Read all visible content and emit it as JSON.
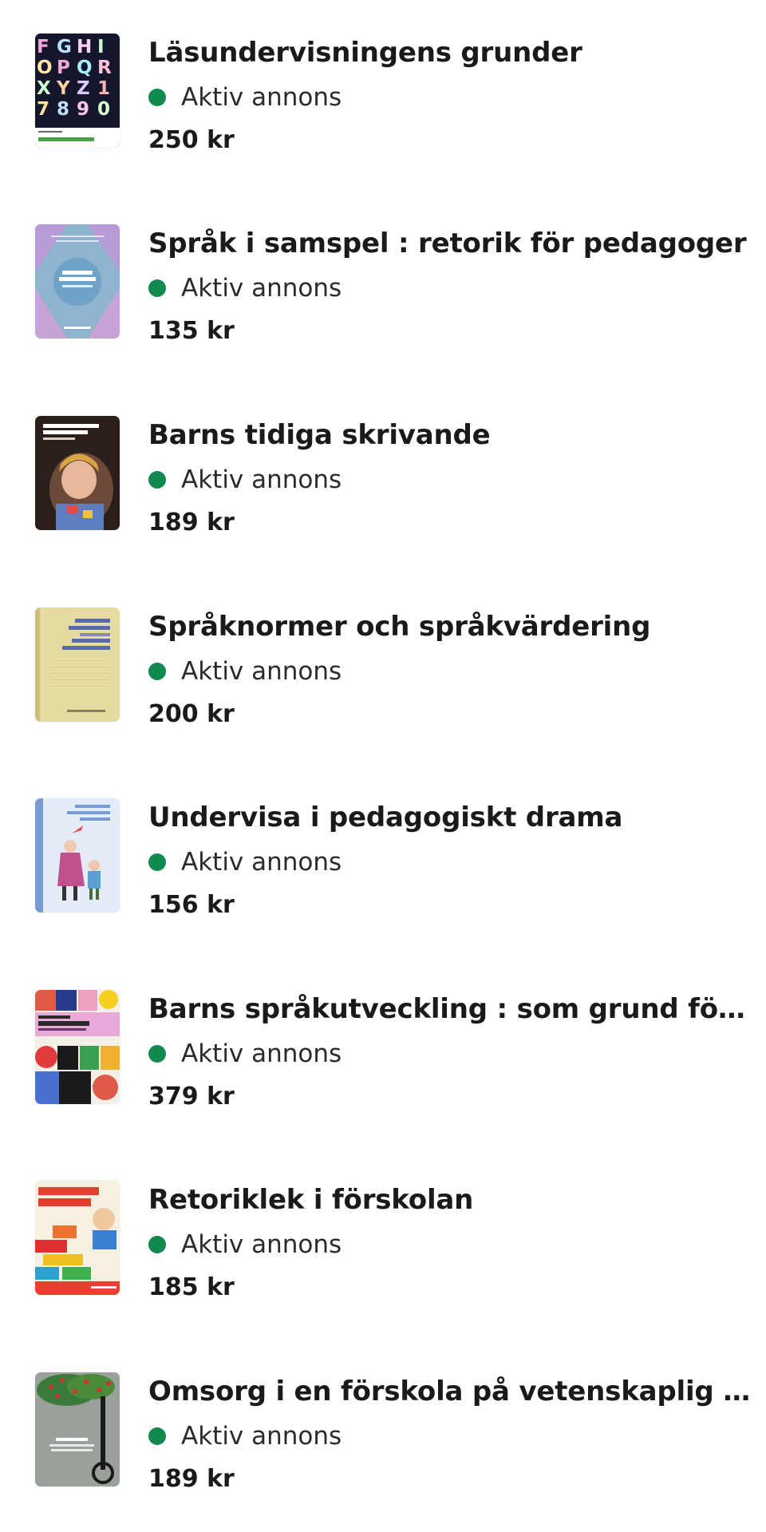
{
  "status_color": "#108a4e",
  "listings": [
    {
      "title": "Läsundervisningens grunder",
      "status": "Aktiv annons",
      "price": "250 kr",
      "cover": "lasundervisning-cover"
    },
    {
      "title": "Språk i samspel : retorik för pedagoger",
      "status": "Aktiv annons",
      "price": "135 kr",
      "cover": "sprak-i-samspel-cover"
    },
    {
      "title": "Barns tidiga skrivande",
      "status": "Aktiv annons",
      "price": "189 kr",
      "cover": "barns-tidiga-skrivande-cover"
    },
    {
      "title": "Språknormer och språkvärdering",
      "status": "Aktiv annons",
      "price": "200 kr",
      "cover": "spraknormer-cover"
    },
    {
      "title": "Undervisa i pedagogiskt drama",
      "status": "Aktiv annons",
      "price": "156 kr",
      "cover": "undervisa-drama-cover"
    },
    {
      "title": "Barns språkutveckling : som grund för språk…",
      "status": "Aktiv annons",
      "price": "379 kr",
      "cover": "barns-sprakutveckling-cover"
    },
    {
      "title": "Retoriklek i förskolan",
      "status": "Aktiv annons",
      "price": "185 kr",
      "cover": "retoriklek-cover"
    },
    {
      "title": "Omsorg i en förskola på vetenskaplig grund",
      "status": "Aktiv annons",
      "price": "189 kr",
      "cover": "omsorg-cover"
    }
  ]
}
